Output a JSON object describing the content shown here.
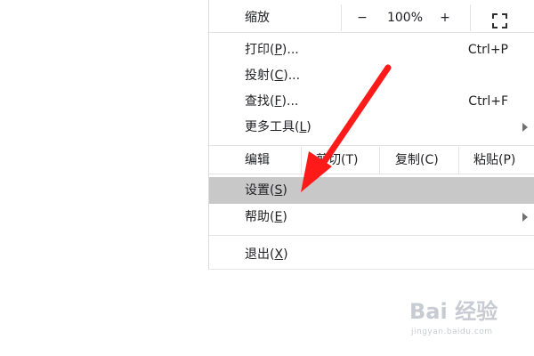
{
  "menu": {
    "zoom": {
      "label": "缩放",
      "minus": "−",
      "value": "100%",
      "plus": "+",
      "fullscreen_icon": "fullscreen-icon"
    },
    "print": {
      "text": "打印",
      "mnemonic": "P",
      "ellipsis": "...",
      "shortcut": "Ctrl+P"
    },
    "cast": {
      "text": "投射",
      "mnemonic": "C",
      "ellipsis": "..."
    },
    "find": {
      "text": "查找",
      "mnemonic": "F",
      "ellipsis": "...",
      "shortcut": "Ctrl+F"
    },
    "more_tools": {
      "text": "更多工具",
      "mnemonic": "L"
    },
    "edit": {
      "label": "编辑",
      "cut": "剪切(T)",
      "copy": "复制(C)",
      "paste": "粘贴(P)"
    },
    "settings": {
      "text": "设置",
      "mnemonic": "S"
    },
    "help": {
      "text": "帮助",
      "mnemonic": "E"
    },
    "exit": {
      "text": "退出",
      "mnemonic": "X"
    }
  },
  "annotation": {
    "arrow_color": "#ff1a1a"
  },
  "watermark": {
    "logo_text": "Bai 经验",
    "url": "jingyan.baidu.com"
  },
  "colors": {
    "highlight": "#c8c8c8",
    "separator": "#e3e3e3",
    "text": "#202124"
  }
}
